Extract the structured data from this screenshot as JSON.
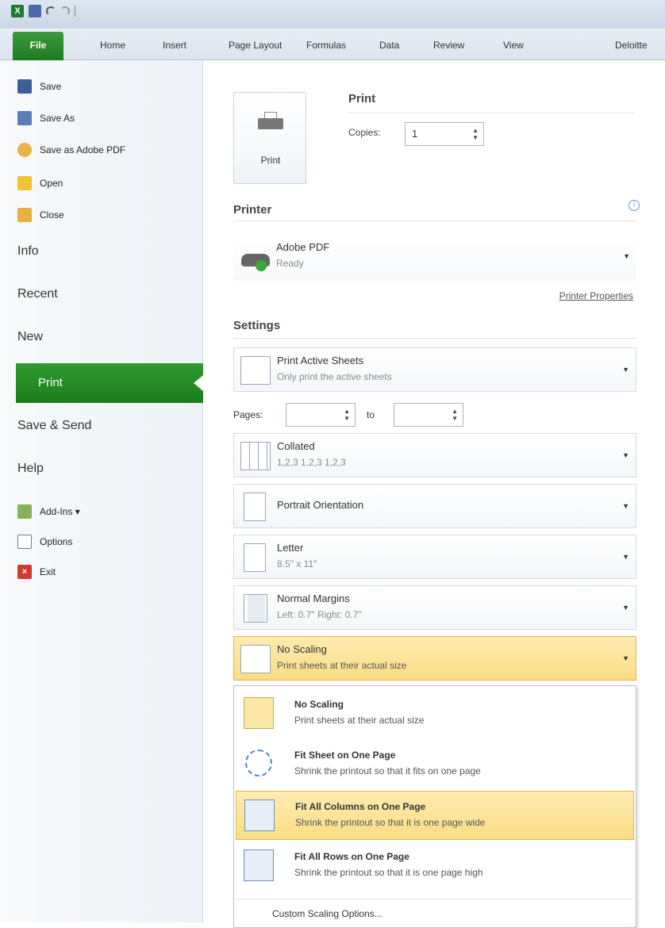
{
  "ribbon": {
    "tabs": [
      "File",
      "Home",
      "Insert",
      "Page Layout",
      "Formulas",
      "Data",
      "Review",
      "View",
      "Deloitte"
    ]
  },
  "backstage": {
    "commands": [
      {
        "label": "Save",
        "icon": "save-icon"
      },
      {
        "label": "Save As",
        "icon": "save-as-icon"
      },
      {
        "label": "Save as Adobe PDF",
        "icon": "pdf-icon"
      },
      {
        "label": "Open",
        "icon": "open-folder-icon"
      },
      {
        "label": "Close",
        "icon": "close-folder-icon"
      }
    ],
    "nav": [
      "Info",
      "Recent",
      "New",
      "Print",
      "Save & Send",
      "Help"
    ],
    "footer": [
      {
        "label": "Add-Ins ▾",
        "icon": "add-ins-icon"
      },
      {
        "label": "Options",
        "icon": "options-icon"
      },
      {
        "label": "Exit",
        "icon": "exit-icon"
      }
    ],
    "active": "Print"
  },
  "print": {
    "button_label": "Print",
    "title": "Print",
    "copies_label": "Copies:",
    "copies_value": "1"
  },
  "printer": {
    "heading": "Printer",
    "name": "Adobe PDF",
    "status": "Ready",
    "properties_link": "Printer Properties"
  },
  "settings": {
    "heading": "Settings",
    "what": {
      "title": "Print Active Sheets",
      "sub": "Only print the active sheets"
    },
    "pages_label": "Pages:",
    "to_label": "to",
    "collation": {
      "title": "Collated",
      "sub": "1,2,3   1,2,3   1,2,3"
    },
    "orientation": {
      "title": "Portrait Orientation"
    },
    "paper": {
      "title": "Letter",
      "sub": "8.5\" x 11\""
    },
    "margins": {
      "title": "Normal Margins",
      "sub": "Left: 0.7\"   Right: 0.7\""
    },
    "scaling": {
      "title": "No Scaling",
      "sub": "Print sheets at their actual size"
    }
  },
  "scaling_menu": {
    "items": [
      {
        "title": "No Scaling",
        "sub": "Print sheets at their actual size"
      },
      {
        "title": "Fit Sheet on One Page",
        "sub": "Shrink the printout so that it fits on one page"
      },
      {
        "title": "Fit All Columns on One Page",
        "sub": "Shrink the printout so that it is one page wide"
      },
      {
        "title": "Fit All Rows on One Page",
        "sub": "Shrink the printout so that it is one page high"
      }
    ],
    "custom": "Custom Scaling Options...",
    "highlighted_index": 2
  },
  "colors": {
    "accent_green": "#2f9b2f",
    "highlight_yellow": "#f9dd83"
  }
}
